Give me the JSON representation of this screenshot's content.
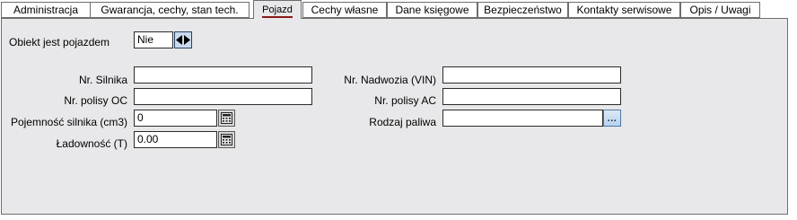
{
  "tabs": [
    {
      "label": "Administracja"
    },
    {
      "label": "Gwarancja, cechy, stan tech."
    },
    {
      "label": "Pojazd"
    },
    {
      "label": "Cechy własne"
    },
    {
      "label": "Dane księgowe"
    },
    {
      "label": "Bezpieczeństwo"
    },
    {
      "label": "Kontakty serwisowe"
    },
    {
      "label": "Opis / Uwagi"
    }
  ],
  "active_tab": "Pojazd",
  "form": {
    "is_vehicle": {
      "label": "Obiekt jest pojazdem",
      "value": "Nie"
    },
    "engine_no": {
      "label": "Nr. Silnika",
      "value": ""
    },
    "oc_policy": {
      "label": "Nr. polisy OC",
      "value": ""
    },
    "engine_capacity": {
      "label": "Pojemność silnika (cm3)",
      "value": "0"
    },
    "load_capacity": {
      "label": "Ładowność (T)",
      "value": "0.00"
    },
    "vin": {
      "label": "Nr. Nadwozia (VIN)",
      "value": ""
    },
    "ac_policy": {
      "label": "Nr. polisy AC",
      "value": ""
    },
    "fuel_type": {
      "label": "Rodzaj paliwa",
      "value": ""
    },
    "fuel_button_label": "..."
  },
  "icons": {
    "spinner": "left-right-arrows-icon",
    "calculator": "calculator-icon",
    "ellipsis": "ellipsis-button"
  }
}
